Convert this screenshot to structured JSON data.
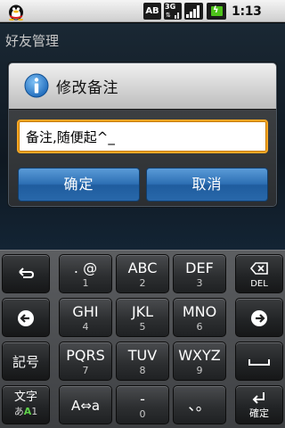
{
  "status_bar": {
    "app_icon": "qq-penguin-icon",
    "input_mode": "AB",
    "network": "3G",
    "signal": "signal-strength-icon",
    "battery": "battery-charging-icon",
    "time": "1:13 AM"
  },
  "background_app": {
    "title": "好友管理"
  },
  "dialog": {
    "icon": "info-icon",
    "title": "修改备注",
    "input_value": "备注,随便起^_",
    "ok_label": "确定",
    "cancel_label": "取消",
    "colors": {
      "input_focus_border": "#f5a623",
      "button_blue": "#2d6fb3"
    }
  },
  "keyboard": {
    "rows": [
      [
        {
          "name": "backspace-arrow",
          "icon": "return-arrow-icon"
        },
        {
          "main": ". @",
          "sub": "1"
        },
        {
          "main": "ABC",
          "sub": "2"
        },
        {
          "main": "DEF",
          "sub": "3"
        },
        {
          "name": "delete",
          "icon": "delete-icon",
          "sub": "DEL"
        }
      ],
      [
        {
          "name": "cursor-left",
          "icon": "arrow-left-icon"
        },
        {
          "main": "GHI",
          "sub": "4"
        },
        {
          "main": "JKL",
          "sub": "5"
        },
        {
          "main": "MNO",
          "sub": "6"
        },
        {
          "name": "cursor-right",
          "icon": "arrow-right-icon"
        }
      ],
      [
        {
          "name": "symbols",
          "label": "記号"
        },
        {
          "main": "PQRS",
          "sub": "7"
        },
        {
          "main": "TUV",
          "sub": "8"
        },
        {
          "main": "WXYZ",
          "sub": "9"
        },
        {
          "name": "space",
          "icon": "space-icon"
        }
      ],
      [
        {
          "name": "input-mode",
          "main": "文字",
          "sub_prefix": "あ",
          "sub_highlight": "A",
          "sub_suffix": "1"
        },
        {
          "name": "case-toggle",
          "label": "A⇔a"
        },
        {
          "main": "-",
          "sub": "0"
        },
        {
          "name": "punctuation",
          "label": "、。"
        },
        {
          "name": "enter",
          "icon": "enter-icon",
          "sub": "確定"
        }
      ]
    ]
  }
}
